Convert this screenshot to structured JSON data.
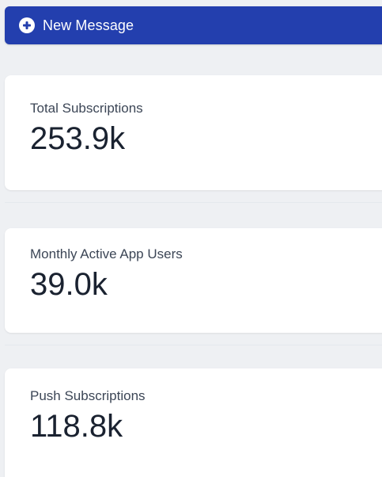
{
  "toolbar": {
    "new_message_label": "New Message"
  },
  "stats": [
    {
      "label": "Total Subscriptions",
      "value": "253.9k"
    },
    {
      "label": "Monthly Active App Users",
      "value": "39.0k"
    },
    {
      "label": "Push Subscriptions",
      "value": "118.8k"
    }
  ],
  "colors": {
    "accent": "#233fae",
    "page_background": "#eef0f3",
    "card_background": "#ffffff",
    "label_text": "#3c4656",
    "value_text": "#1a2230"
  },
  "icons": {
    "new_message": "plus-icon"
  }
}
